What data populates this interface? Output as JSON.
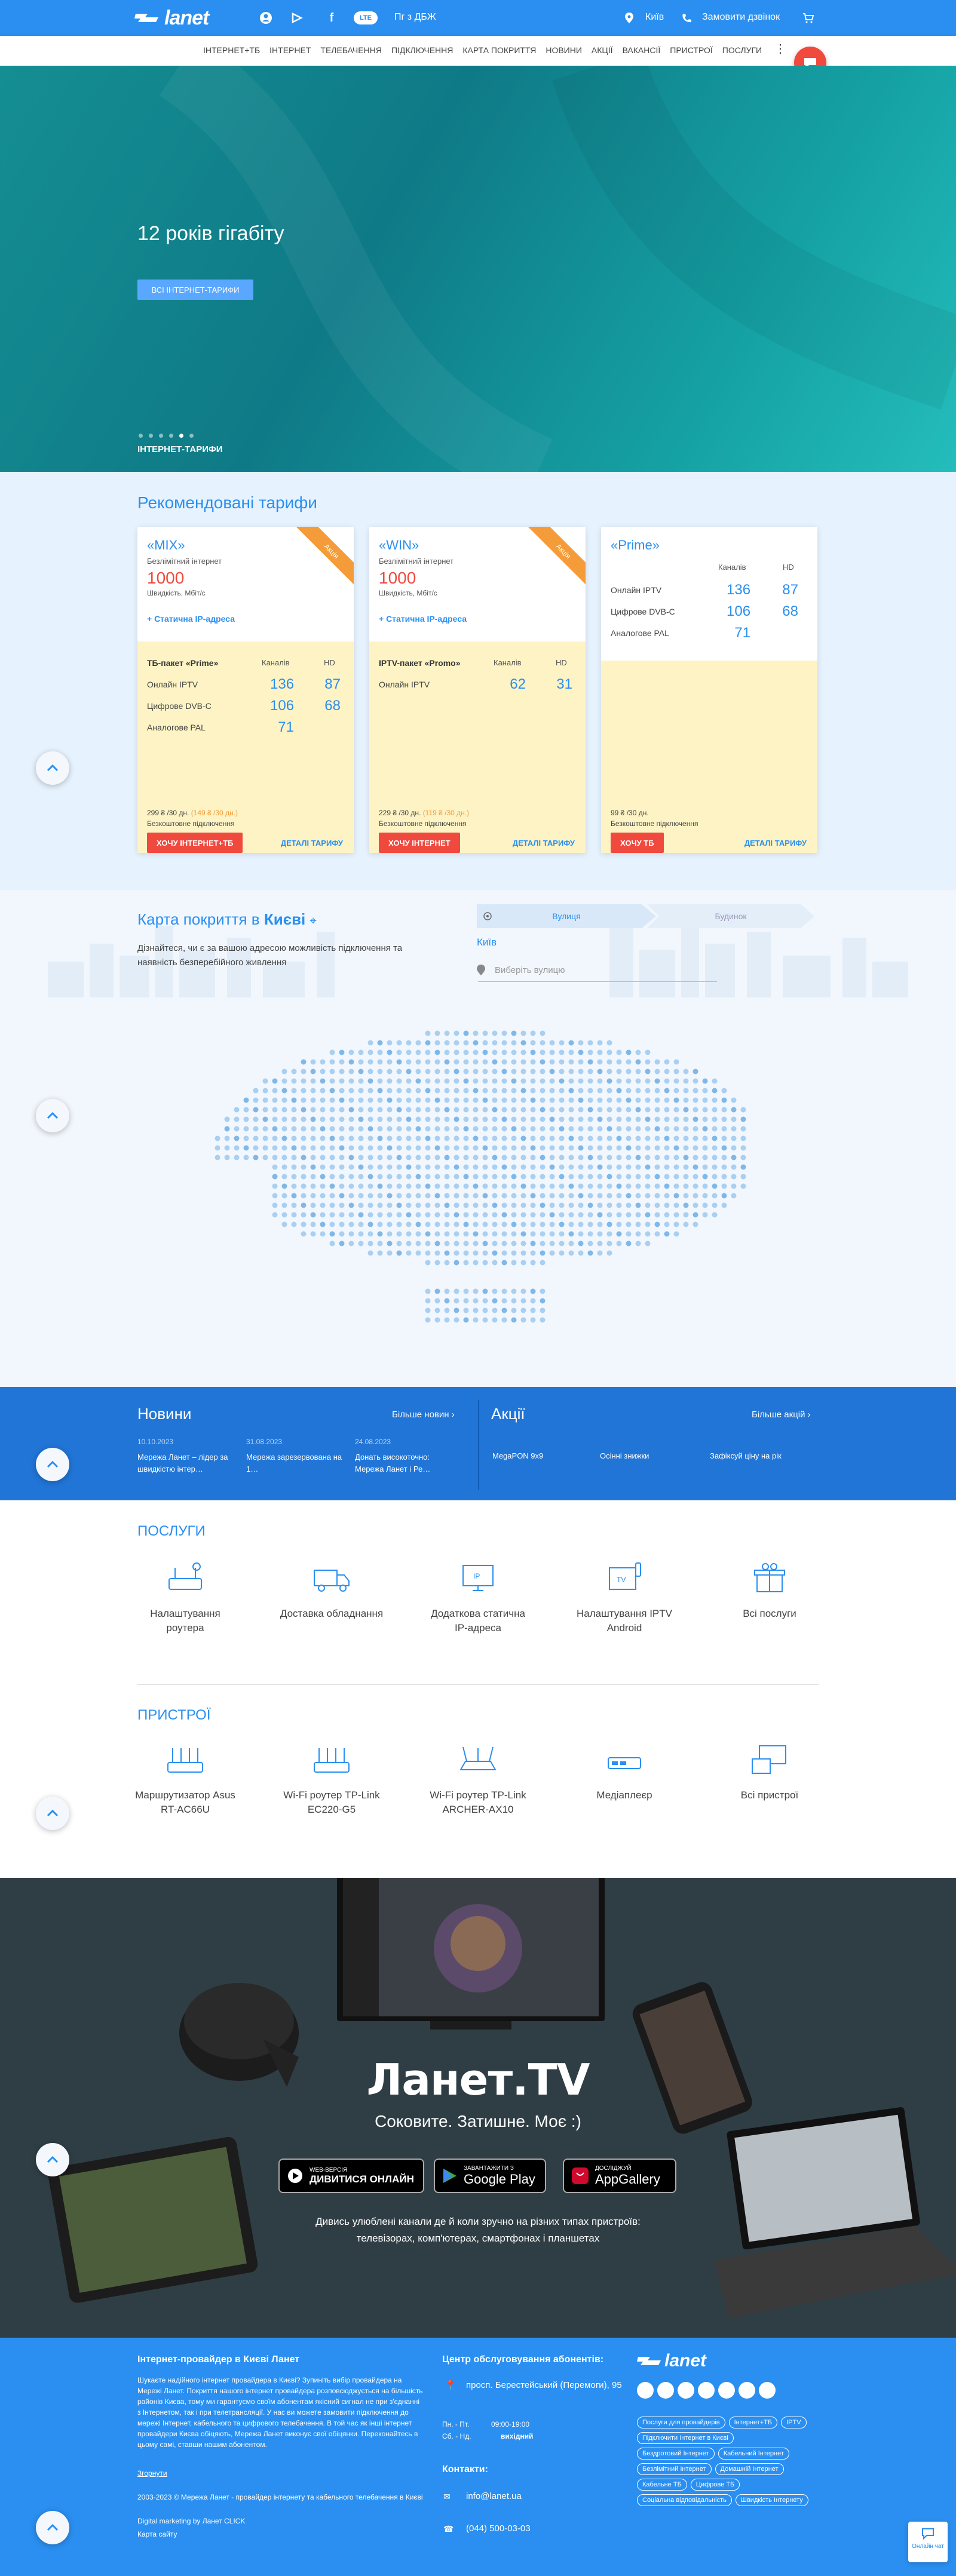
{
  "header": {
    "logo": "lanet",
    "lte": "LTE",
    "pg_dbzh": "Пг з ДБЖ",
    "city": "Київ",
    "callback": "Замовити дзвінок",
    "nav": [
      "Інтернет+ТБ",
      "Інтернет",
      "Телебачення",
      "Підключення",
      "Карта покриття",
      "Новини",
      "Акції",
      "Вакансії",
      "Пристрої",
      "Послуги"
    ]
  },
  "hero": {
    "title": "12 років гігабіту",
    "button": "Всі інтернет-тарифи",
    "caption": "Інтернет-тарифи",
    "slides": 6,
    "active_slide": 5
  },
  "tariffs": {
    "heading": "Рекомендовані тарифи",
    "cards": [
      {
        "name": "«MIX»",
        "ribbon": "Акція",
        "subtitle": "Безлімітний інтернет",
        "speed": "1000",
        "speed_label": "Швидкість, Мбіт/с",
        "static_ip": "+ Статична IP-адреса",
        "package": "ТБ-пакет «Prime»",
        "col_channels": "Каналів",
        "col_hd": "HD",
        "rows": [
          {
            "label": "Онлайн IPTV",
            "channels": "136",
            "hd": "87"
          },
          {
            "label": "Цифрове DVB-C",
            "channels": "106",
            "hd": "68"
          },
          {
            "label": "Аналогове PAL",
            "channels": "71",
            "hd": ""
          }
        ],
        "price": "299 ₴ /30 дн.",
        "old_price": "(149 ₴ /30 дн.)",
        "connection": "Безкоштовне підключення",
        "button": "Хочу Інтернет+ТБ",
        "details": "Деталі тарифу"
      },
      {
        "name": "«WIN»",
        "ribbon": "Акція",
        "subtitle": "Безлімітний інтернет",
        "speed": "1000",
        "speed_label": "Швидкість, Мбіт/с",
        "static_ip": "+ Статична IP-адреса",
        "package": "IPTV-пакет «Promo»",
        "col_channels": "Каналів",
        "col_hd": "HD",
        "rows": [
          {
            "label": "Онлайн IPTV",
            "channels": "62",
            "hd": "31"
          }
        ],
        "price": "229 ₴ /30 дн.",
        "old_price": "(119 ₴ /30 дн.)",
        "connection": "Безкоштовне підключення",
        "button": "Хочу інтернет",
        "details": "Деталі тарифу"
      },
      {
        "name": "«Prime»",
        "subtitle": "",
        "col_channels": "Каналів",
        "col_hd": "HD",
        "rows": [
          {
            "label": "Онлайн IPTV",
            "channels": "136",
            "hd": "87"
          },
          {
            "label": "Цифрове DVB-C",
            "channels": "106",
            "hd": "68"
          },
          {
            "label": "Аналогове PAL",
            "channels": "71",
            "hd": ""
          }
        ],
        "price": "99 ₴ /30 дн.",
        "connection": "Безкоштовне підключення",
        "button": "Хочу ТБ",
        "details": "Деталі тарифу"
      }
    ]
  },
  "coverage": {
    "heading_prefix": "Карта покриття в",
    "heading_city": "Києві",
    "description": "Дізнайтеся, чи є за вашою адресою можливість підключення та наявність безперебійного живлення",
    "tab_street": "Вулиця",
    "tab_building": "Будинок",
    "city": "Київ",
    "street_placeholder": "Виберіть вулицю"
  },
  "news": {
    "heading": "Новини",
    "more": "Більше новин",
    "items": [
      {
        "date": "10.10.2023",
        "text": "Мережа Ланет – лідер за швидкістю інтер…"
      },
      {
        "date": "31.08.2023",
        "text": "Мережа зарезервована на 1…"
      },
      {
        "date": "24.08.2023",
        "text": "Донать високоточно: Мережа Ланет і Ре…"
      }
    ]
  },
  "promos": {
    "heading": "Акції",
    "more": "Більше акцій",
    "items": [
      "MegaPON 9х9",
      "Осінні знижки",
      "Зафіксуй ціну на рік"
    ]
  },
  "services": {
    "heading": "Послуги",
    "items": [
      "Налаштування роутера",
      "Доставка обладнання",
      "Додаткова статична IP-адреса",
      "Налаштування IPTV Android",
      "Всі послуги"
    ]
  },
  "devices": {
    "heading": "Пристрої",
    "items": [
      "Маршрутизатор Asus RT-AC66U",
      "Wi-Fi роутер TP-Link EC220-G5",
      "Wi-Fi роутер TP-Link ARCHER-AX10",
      "Медіаплеєр",
      "Всі пристрої"
    ]
  },
  "tv": {
    "title": "Ланет.TV",
    "slogan": "Соковите. Затишне. Моє :)",
    "store_web_top": "Web-версія",
    "store_web": "Дивитися онлайн",
    "store_gp_top": "Завантажити з",
    "store_gp": "Google Play",
    "store_ag_top": "Досліджуй",
    "store_ag": "AppGallery",
    "watch": "Дивись улюблені канали де й коли зручно на різних типах пристроїв: телевізорах, комп'ютерах, смартфонах і планшетах"
  },
  "footer": {
    "about_title": "Інтернет-провайдер в Києві Ланет",
    "about_text": "Шукаєте надійного інтернет провайдера в Києві? Зупиніть вибір провайдера на Мережі Ланет. Покриття нашого інтернет провайдера розповсюджується на більшість районів Києва, тому ми гарантуємо своїм абонентам якісний сигнал не при з'єднанні з Інтернетом, так і при телетрансляції. У нас ви можете замовити підключення до мережі Інтернет, кабельного та цифрового телебачення. В той час як інші інтернет провайдери Києва обіцяють, Мережа Ланет виконує свої обіцянки. Переконайтесь в цьому самі, ставши нашим абонентом.",
    "collapse": "Згорнути",
    "copyright": "2003-2023 © Мережа Ланет - провайдер інтернету та кабельного телебачення в Києві",
    "marketing": "Digital marketing by Ланет CLICK",
    "sitemap": "Карта сайту",
    "center_title": "Центр обслуговування абонентів:",
    "address": "просп. Берестейський (Перемоги), 95",
    "hours_days": "Пн. - Пт.",
    "hours_time": "09:00-19:00",
    "weekend_days": "Сб. - Нд.",
    "weekend": "вихідний",
    "contacts_title": "Контакти:",
    "email": "info@lanet.ua",
    "phone": "(044) 500-03-03",
    "tags": [
      "Послуги для провайдерів",
      "Інтернет+ТБ",
      "IPTV",
      "Підключити Інтернет в Києві",
      "Бездротовий Інтернет",
      "Кабельний Інтернет",
      "Безлімітний Інтернет",
      "Домашній Інтернет",
      "Кабельне ТБ",
      "Цифрове ТБ",
      "Соціальна відповідальність",
      "Швидкість Інтернету"
    ],
    "chat": "Онлайн чат"
  }
}
